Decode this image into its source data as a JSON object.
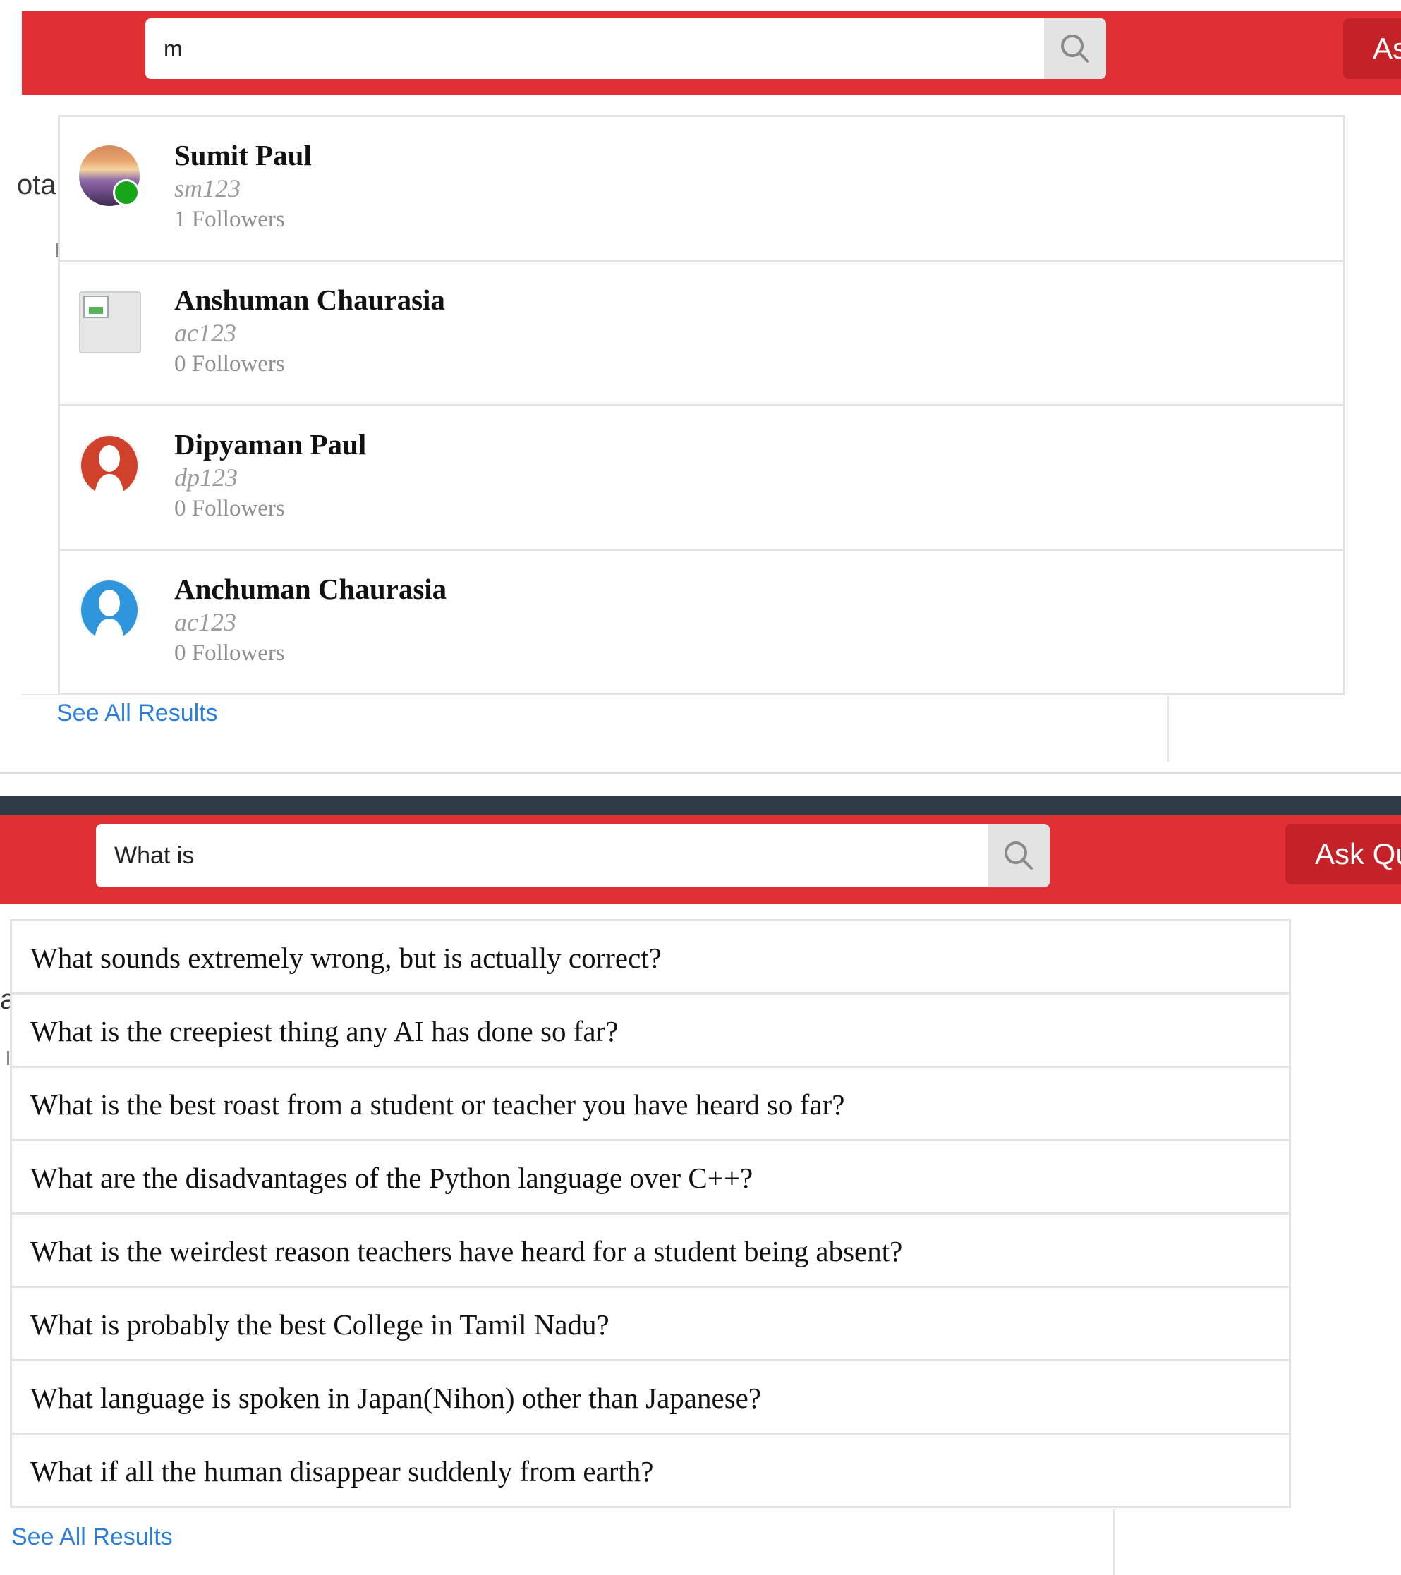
{
  "people_search": {
    "query": "m",
    "ask_button_label": "As",
    "behind_text": "ota",
    "results": [
      {
        "name": "Sumit Paul",
        "handle": "sm123",
        "followers": "1 Followers",
        "avatar": "photo",
        "online": true
      },
      {
        "name": "Anshuman Chaurasia",
        "handle": "ac123",
        "followers": "0 Followers",
        "avatar": "broken-image",
        "online": false
      },
      {
        "name": "Dipyaman Paul",
        "handle": "dp123",
        "followers": "0 Followers",
        "avatar": "default-user",
        "avatar_color": "#d0412c",
        "online": false
      },
      {
        "name": "Anchuman Chaurasia",
        "handle": "ac123",
        "followers": "0 Followers",
        "avatar": "default-user",
        "avatar_color": "#2f95dd",
        "online": false
      }
    ],
    "see_all_label": "See All Results"
  },
  "question_search": {
    "query": "What is",
    "ask_button_label": "Ask Qu",
    "behind_text": "a",
    "results": [
      "What sounds extremely wrong, but is actually correct?",
      "What is the creepiest thing any AI has done so far?",
      "What is the best roast from a student or teacher you have heard so far?",
      "What are the disadvantages of the Python language over C++?",
      "What is the weirdest reason teachers have heard for a student being absent?",
      "What is probably the best College in Tamil Nadu?",
      "What language is spoken in Japan(Nihon) other than Japanese?",
      "What if all the human disappear suddenly from earth?"
    ],
    "see_all_label": "See All Results"
  },
  "colors": {
    "header_red": "#e03034",
    "ask_button_red": "#c42228",
    "dark_band": "#2e3c45",
    "link_blue": "#2c7fd8",
    "online_green": "#17a519"
  },
  "icons": {
    "search": "search-icon",
    "default_user": "user-silhouette-icon"
  }
}
